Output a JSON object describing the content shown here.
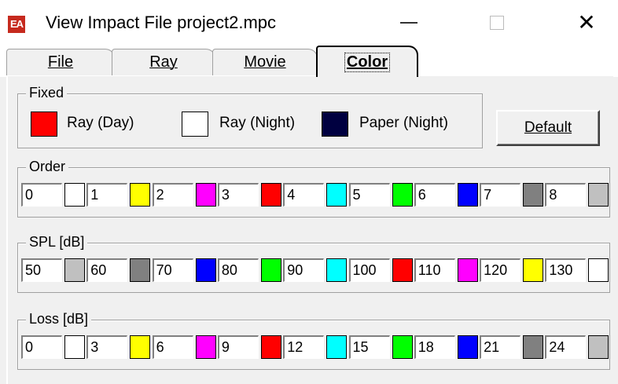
{
  "window": {
    "title": "View Impact File project2.mpc",
    "icon_text": "EA"
  },
  "tabs": [
    {
      "label": "File",
      "active": false
    },
    {
      "label": "Ray",
      "active": false
    },
    {
      "label": "Movie",
      "active": false
    },
    {
      "label": "Color",
      "active": true
    }
  ],
  "fixed": {
    "legend": "Fixed",
    "items": [
      {
        "label": "Ray (Day)",
        "color": "#ff0000"
      },
      {
        "label": "Ray (Night)",
        "color": "#ffffff"
      },
      {
        "label": "Paper (Night)",
        "color": "#000040"
      }
    ],
    "default_button": "Default"
  },
  "order": {
    "legend": "Order",
    "entries": [
      {
        "value": "0",
        "color": "#ffffff"
      },
      {
        "value": "1",
        "color": "#ffff00"
      },
      {
        "value": "2",
        "color": "#ff00ff"
      },
      {
        "value": "3",
        "color": "#ff0000"
      },
      {
        "value": "4",
        "color": "#00ffff"
      },
      {
        "value": "5",
        "color": "#00ff00"
      },
      {
        "value": "6",
        "color": "#0000ff"
      },
      {
        "value": "7",
        "color": "#808080"
      },
      {
        "value": "8",
        "color": "#c0c0c0"
      }
    ]
  },
  "spl": {
    "legend": "SPL [dB]",
    "entries": [
      {
        "value": "50",
        "color": "#c0c0c0"
      },
      {
        "value": "60",
        "color": "#808080"
      },
      {
        "value": "70",
        "color": "#0000ff"
      },
      {
        "value": "80",
        "color": "#00ff00"
      },
      {
        "value": "90",
        "color": "#00ffff"
      },
      {
        "value": "100",
        "color": "#ff0000"
      },
      {
        "value": "110",
        "color": "#ff00ff"
      },
      {
        "value": "120",
        "color": "#ffff00"
      },
      {
        "value": "130",
        "color": "#ffffff"
      }
    ]
  },
  "loss": {
    "legend": "Loss [dB]",
    "entries": [
      {
        "value": "0",
        "color": "#ffffff"
      },
      {
        "value": "3",
        "color": "#ffff00"
      },
      {
        "value": "6",
        "color": "#ff00ff"
      },
      {
        "value": "9",
        "color": "#ff0000"
      },
      {
        "value": "12",
        "color": "#00ffff"
      },
      {
        "value": "15",
        "color": "#00ff00"
      },
      {
        "value": "18",
        "color": "#0000ff"
      },
      {
        "value": "21",
        "color": "#808080"
      },
      {
        "value": "24",
        "color": "#c0c0c0"
      }
    ]
  }
}
